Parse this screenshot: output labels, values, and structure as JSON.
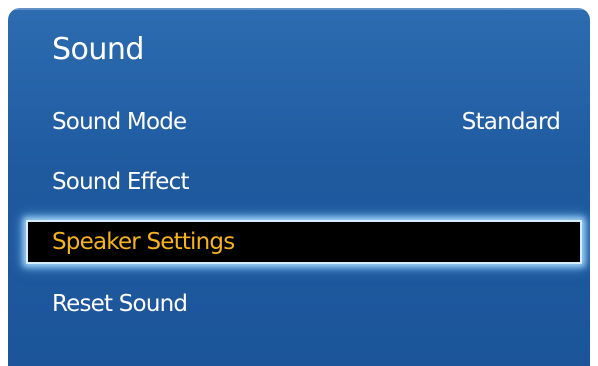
{
  "menu": {
    "title": "Sound",
    "items": [
      {
        "label": "Sound Mode",
        "value": "Standard"
      },
      {
        "label": "Sound Effect",
        "value": ""
      },
      {
        "label": "Speaker Settings",
        "value": "",
        "selected": true
      },
      {
        "label": "Reset Sound",
        "value": ""
      }
    ]
  },
  "colors": {
    "panel_background": "#1f5a9f",
    "selected_background": "#000000",
    "selected_text": "#f5b31c",
    "selected_glow": "#aadcff",
    "text": "#ffffff"
  }
}
